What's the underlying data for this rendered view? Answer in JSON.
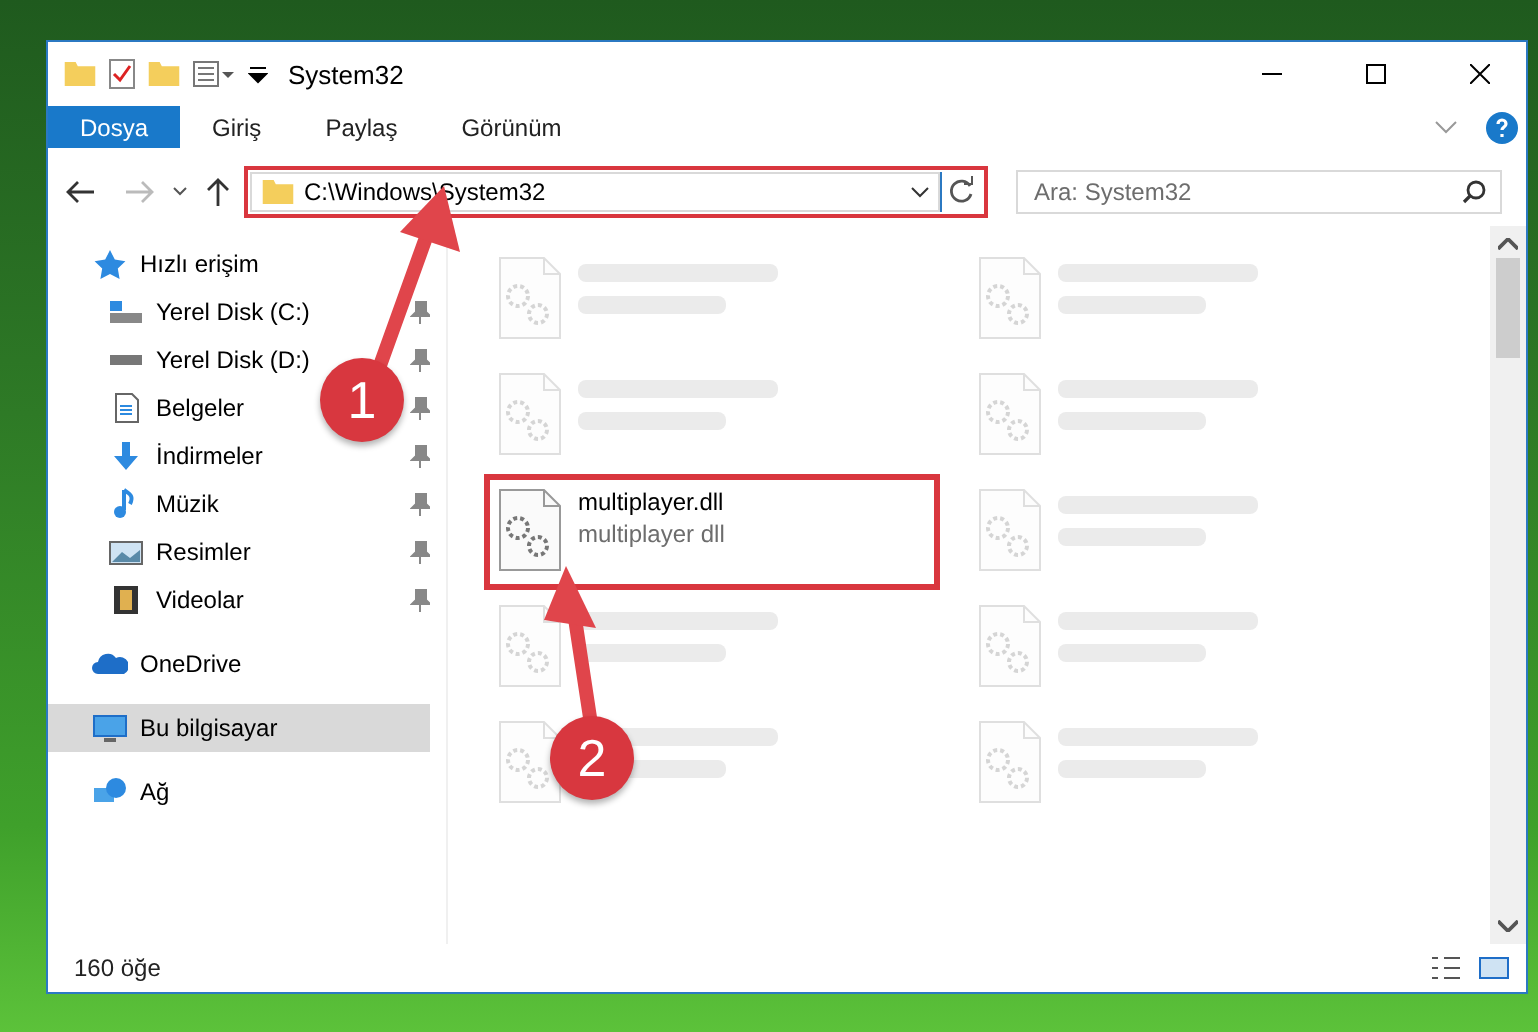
{
  "window": {
    "title": "System32"
  },
  "ribbon_tabs": [
    {
      "label": "Dosya",
      "selected": true
    },
    {
      "label": "Giriş",
      "selected": false
    },
    {
      "label": "Paylaş",
      "selected": false
    },
    {
      "label": "Görünüm",
      "selected": false
    }
  ],
  "address_bar": {
    "path": "C:\\Windows\\System32"
  },
  "search": {
    "placeholder": "Ara: System32"
  },
  "sidebar": {
    "items": [
      {
        "label": "Hızlı erişim",
        "kind": "star",
        "selected": false,
        "children": [
          {
            "label": "Yerel Disk (C:)",
            "kind": "drive-c",
            "selected": false,
            "pinned": true
          },
          {
            "label": "Yerel Disk (D:)",
            "kind": "drive",
            "selected": false,
            "pinned": true
          },
          {
            "label": "Belgeler",
            "kind": "docs",
            "selected": false,
            "pinned": true
          },
          {
            "label": "İndirmeler",
            "kind": "download",
            "selected": false,
            "pinned": true
          },
          {
            "label": "Müzik",
            "kind": "music",
            "selected": false,
            "pinned": true
          },
          {
            "label": "Resimler",
            "kind": "pictures",
            "selected": false,
            "pinned": true
          },
          {
            "label": "Videolar",
            "kind": "video",
            "selected": false,
            "pinned": true
          }
        ]
      },
      {
        "label": "OneDrive",
        "kind": "cloud",
        "selected": false
      },
      {
        "label": "Bu bilgisayar",
        "kind": "pc",
        "selected": true
      },
      {
        "label": "Ağ",
        "kind": "network",
        "selected": false
      }
    ]
  },
  "files": [
    {
      "kind": "blurred"
    },
    {
      "kind": "blurred"
    },
    {
      "kind": "blurred"
    },
    {
      "kind": "blurred"
    },
    {
      "kind": "file",
      "name": "multiplayer.dll",
      "type": "multiplayer dll",
      "highlighted": true
    },
    {
      "kind": "blurred"
    },
    {
      "kind": "blurred"
    },
    {
      "kind": "blurred"
    },
    {
      "kind": "blurred"
    },
    {
      "kind": "blurred"
    }
  ],
  "status_bar": {
    "count": "160 öğe"
  },
  "annotations": [
    {
      "label": "1"
    },
    {
      "label": "2"
    }
  ]
}
